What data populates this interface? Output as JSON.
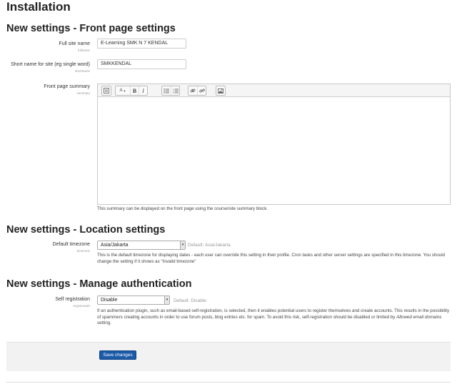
{
  "page": {
    "title": "Installation"
  },
  "front_page": {
    "heading": "New settings - Front page settings",
    "fullname": {
      "label": "Full site name",
      "key": "fullname",
      "value": "E-Learning SMK N 7 KENDAL"
    },
    "shortname": {
      "label": "Short name for site (eg single word)",
      "key": "shortname",
      "value": "SMKKENDAL"
    },
    "summary": {
      "label": "Front page summary",
      "key": "summary",
      "help": "This summary can be displayed on the front page using the course/site summary block."
    }
  },
  "toolbar": {
    "icons": [
      "collapse-icon",
      "font-style-icon",
      "bold-icon",
      "italic-icon",
      "unordered-list-icon",
      "ordered-list-icon",
      "link-icon",
      "unlink-icon",
      "image-icon"
    ],
    "bold": "B",
    "italic": "I",
    "style": "A"
  },
  "location": {
    "heading": "New settings - Location settings",
    "timezone": {
      "label": "Default timezone",
      "key": "timezone",
      "value": "Asia/Jakarta",
      "default": "Default: Asia/Jakarta",
      "help": "This is the default timezone for displaying dates - each user can override this setting in their profile. Cron tasks and other server settings are specified in this timezone. You should change the setting if it shows as \"Invalid timezone\""
    }
  },
  "auth": {
    "heading": "New settings - Manage authentication",
    "registration": {
      "label": "Self registration",
      "key": "registerauth",
      "value": "Disable",
      "default": "Default: Disable",
      "help_before": "If an authentication plugin, such as email-based self-registration, is selected, then it enables potential users to register themselves and create accounts. This results in the possibility of spammers creating accounts in order to use forum posts, blog entries etc. for spam. To avoid this risk, self-registration should be disabled or limited by ",
      "help_em": "Allowed email domains",
      "help_after": " setting."
    }
  },
  "actions": {
    "save": "Save changes"
  },
  "colors": {
    "primary_button": "#1a5aa8",
    "footer_bg": "#f2f2f2"
  }
}
